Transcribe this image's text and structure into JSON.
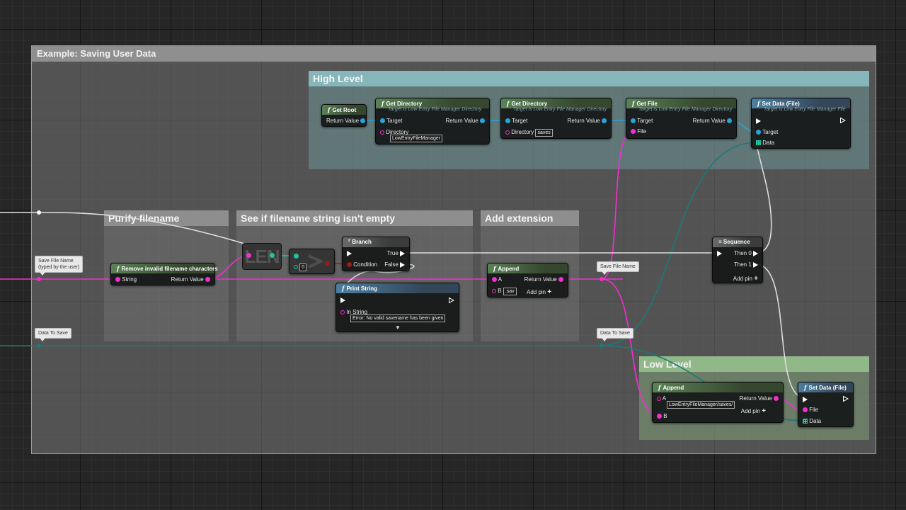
{
  "main_comment": {
    "title": "Example: Saving User Data"
  },
  "groups": {
    "high_level": "High Level",
    "purify": "Purify filename",
    "empty_check": "See if filename string isn't empty",
    "add_ext": "Add extension",
    "low_level": "Low Level"
  },
  "nodes": {
    "get_root": {
      "title": "Get Root",
      "return": "Return Value"
    },
    "get_dir1": {
      "title": "Get Directory",
      "subtitle": "Target is Low Entry File Manager Directory",
      "target": "Target",
      "return": "Return Value",
      "dir_label": "Directory",
      "dir_value": "LowEntryFileManager"
    },
    "get_dir2": {
      "title": "Get Directory",
      "subtitle": "Target is Low Entry File Manager Directory",
      "target": "Target",
      "return": "Return Value",
      "dir_label": "Directory",
      "dir_value": "saves"
    },
    "get_file": {
      "title": "Get File",
      "subtitle": "Target is Low Entry File Manager Directory",
      "target": "Target",
      "return": "Return Value",
      "file": "File"
    },
    "set_data_hl": {
      "title": "Set Data (File)",
      "subtitle": "Target is Low Entry File Manager File",
      "target": "Target",
      "data": "Data"
    },
    "remove_invalid": {
      "title": "Remove invalid filename characters",
      "in": "String",
      "return": "Return Value"
    },
    "len": {
      "label": "LEN"
    },
    "greater": {
      "value": "0"
    },
    "branch": {
      "title": "Branch",
      "true": "True",
      "condition": "Condition",
      "false": "False"
    },
    "print": {
      "title": "Print String",
      "in": "In String",
      "value": "Error: No valid savename has been given"
    },
    "append1": {
      "title": "Append",
      "a": "A",
      "b": "B",
      "b_value": ".sav",
      "return": "Return Value",
      "add_pin": "Add pin"
    },
    "sequence": {
      "title": "Sequence",
      "then0": "Then 0",
      "then1": "Then 1",
      "add_pin": "Add pin"
    },
    "append2": {
      "title": "Append",
      "a": "A",
      "a_value": "LowEntryFileManager/saves/",
      "b": "B",
      "return": "Return Value",
      "add_pin": "Add pin"
    },
    "set_data_ll": {
      "title": "Set Data (File)",
      "file": "File",
      "data": "Data"
    }
  },
  "notes": {
    "save_file_name_1": [
      "Save File Name",
      "(typed by the user)"
    ],
    "data_to_save_1": "Data To Save",
    "save_file_name_2": "Save File Name",
    "data_to_save_2": "Data To Save"
  },
  "colors": {
    "string": "#f32ed0",
    "object": "#2aa3d8",
    "struct": "#1fc4a0",
    "bool": "#9a1b1b",
    "exec": "#ffffff"
  }
}
